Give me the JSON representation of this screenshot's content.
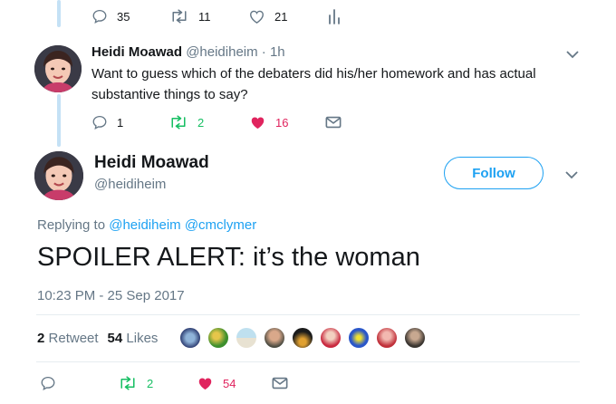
{
  "top_tweet": {
    "reply_count": "35",
    "retweet_count": "11",
    "like_count": "21"
  },
  "reply_tweet": {
    "author_name": "Heidi Moawad",
    "author_handle": "@heidiheim",
    "time_ago": "· 1h",
    "text": "Want to guess which of the debaters did his/her homework and has actual substantive things to say?",
    "reply_count": "1",
    "retweet_count": "2",
    "like_count": "16"
  },
  "main_tweet": {
    "author_name": "Heidi Moawad",
    "author_handle": "@heidiheim",
    "follow_label": "Follow",
    "replying_prefix": "Replying to",
    "replying_to": "@heidiheim @cmclymer",
    "text": "SPOILER ALERT: it’s the woman",
    "timestamp": "10:23 PM - 25 Sep 2017",
    "retweet_count": "2",
    "retweet_label": "Retweet",
    "like_count": "54",
    "like_label": "Likes",
    "action_retweet_count": "2",
    "action_like_count": "54"
  },
  "colors": {
    "accent": "#1da1f2",
    "retweet_green": "#17bf63",
    "like_red": "#e0245e",
    "muted": "#657786",
    "thread_line": "#c4e1f5"
  },
  "likers_avatar_count": 9
}
